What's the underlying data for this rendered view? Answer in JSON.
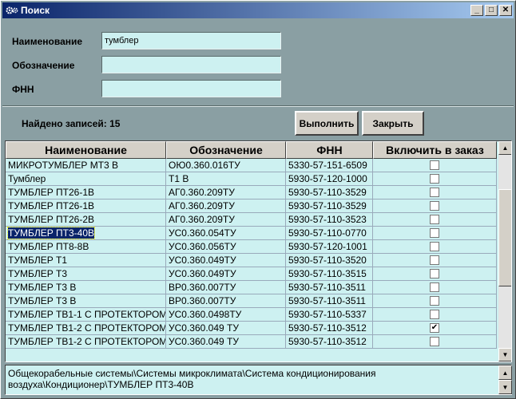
{
  "window": {
    "title": "Поиск",
    "controls": {
      "minimize": "_",
      "maximize": "□",
      "close": "✕"
    }
  },
  "form": {
    "name_label": "Наименование",
    "name_value": "тумблер",
    "designation_label": "Обозначение",
    "designation_value": "",
    "fnn_label": "ФНН",
    "fnn_value": ""
  },
  "status": {
    "found_text": "Найдено записей: 15"
  },
  "buttons": {
    "run": "Выполнить",
    "close": "Закрыть"
  },
  "table": {
    "columns": [
      "Наименование",
      "Обозначение",
      "ФНН",
      "Включить в заказ"
    ],
    "rows": [
      {
        "name": "МИКРОТУМБЛЕР МТ3 В",
        "designation": "ОЮ0.360.016ТУ",
        "fnn": "5330-57-151-6509",
        "include": false
      },
      {
        "name": "Тумблер",
        "designation": "Т1 В",
        "fnn": "5930-57-120-1000",
        "include": false
      },
      {
        "name": "ТУМБЛЕР ПТ26-1В",
        "designation": "АГ0.360.209ТУ",
        "fnn": "5930-57-110-3529",
        "include": false
      },
      {
        "name": "ТУМБЛЕР ПТ26-1В",
        "designation": "АГ0.360.209ТУ",
        "fnn": "5930-57-110-3529",
        "include": false
      },
      {
        "name": "ТУМБЛЕР ПТ26-2В",
        "designation": "АГ0.360.209ТУ",
        "fnn": "5930-57-110-3523",
        "include": false
      },
      {
        "name": "ТУМБЛЕР ПТ3-40В",
        "designation": "УС0.360.054ТУ",
        "fnn": "5930-57-110-0770",
        "include": false,
        "selected": true
      },
      {
        "name": "ТУМБЛЕР ПТ8-8В",
        "designation": "УС0.360.056ТУ",
        "fnn": "5930-57-120-1001",
        "include": false
      },
      {
        "name": "ТУМБЛЕР Т1",
        "designation": "УС0.360.049ТУ",
        "fnn": "5930-57-110-3520",
        "include": false
      },
      {
        "name": "ТУМБЛЕР Т3",
        "designation": "УС0.360.049ТУ",
        "fnn": "5930-57-110-3515",
        "include": false
      },
      {
        "name": "ТУМБЛЕР Т3 В",
        "designation": "ВР0.360.007ТУ",
        "fnn": "5930-57-110-3511",
        "include": false
      },
      {
        "name": "ТУМБЛЕР Т3 В",
        "designation": "ВР0.360.007ТУ",
        "fnn": "5930-57-110-3511",
        "include": false
      },
      {
        "name": "ТУМБЛЕР ТВ1-1 С ПРОТЕКТОРОМ",
        "designation": "УС0.360.0498ТУ",
        "fnn": "5930-57-110-5337",
        "include": false
      },
      {
        "name": "ТУМБЛЕР ТВ1-2 С ПРОТЕКТОРОМ",
        "designation": "УС0.360.049 ТУ",
        "fnn": "5930-57-110-3512",
        "include": true
      },
      {
        "name": "ТУМБЛЕР ТВ1-2 С ПРОТЕКТОРОМ",
        "designation": "УС0.360.049 ТУ",
        "fnn": "5930-57-110-3512",
        "include": false
      }
    ]
  },
  "path": {
    "text": "Общекорабельные системы\\Системы микроклимата\\Система кондиционирования воздуха\\Кондиционер\\ТУМБЛЕР ПТ3-40В"
  },
  "icons": {
    "app": "gears-icon",
    "scroll_up": "▲",
    "scroll_down": "▼",
    "check": "✔"
  }
}
